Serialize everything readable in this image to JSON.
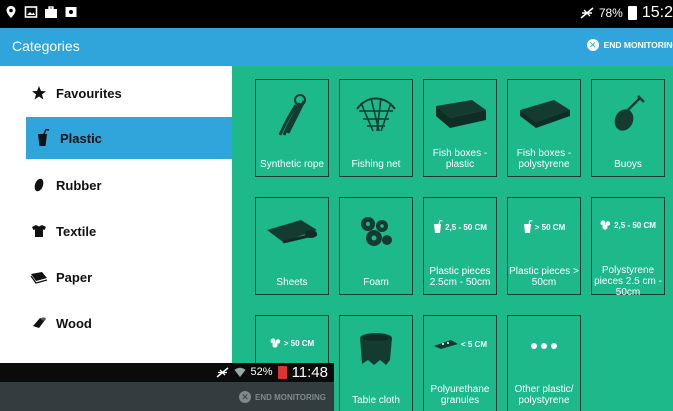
{
  "status_bar": {
    "battery": "78%",
    "time": "15:2"
  },
  "app_bar": {
    "title": "Categories",
    "end_monitoring": "END MONITORING"
  },
  "sidebar": {
    "items": [
      {
        "label": "Favourites",
        "icon": "star-icon"
      },
      {
        "label": "Plastic",
        "icon": "plastic-cup-icon",
        "active": true
      },
      {
        "label": "Rubber",
        "icon": "rubber-icon"
      },
      {
        "label": "Textile",
        "icon": "tshirt-icon"
      },
      {
        "label": "Paper",
        "icon": "paper-icon"
      },
      {
        "label": "Wood",
        "icon": "wood-icon"
      }
    ]
  },
  "tiles": [
    {
      "label": "Synthetic rope",
      "icon": "rope-icon"
    },
    {
      "label": "Fishing net",
      "icon": "fishing-net-icon"
    },
    {
      "label": "Fish boxes - plastic",
      "icon": "fish-box-icon"
    },
    {
      "label": "Fish boxes - polystyrene",
      "icon": "fish-box-polystyrene-icon"
    },
    {
      "label": "Buoys",
      "icon": "buoy-icon"
    },
    {
      "label": "Sheets",
      "icon": "sheet-roll-icon"
    },
    {
      "label": "Foam",
      "icon": "foam-icon"
    },
    {
      "label": "Plastic pieces 2.5cm - 50cm",
      "badge": "2,5 - 50 CM",
      "icon": "plastic-cup-icon"
    },
    {
      "label": "Plastic pieces > 50cm",
      "badge": "> 50 CM",
      "icon": "plastic-cup-icon"
    },
    {
      "label": "Polystyrene pieces 2.5 cm - 50cm",
      "badge": "2,5 - 50 CM",
      "icon": "polystyrene-icon"
    },
    {
      "label": "",
      "badge": "> 50 CM",
      "icon": "polystyrene-icon"
    },
    {
      "label": "Table cloth",
      "icon": "table-cloth-icon"
    },
    {
      "label": "Polyurethane granules",
      "badge": "< 5 CM",
      "icon": "granules-icon"
    },
    {
      "label": "Other plastic/ polystyrene",
      "icon": "more-dots-icon"
    }
  ],
  "overlay": {
    "battery": "52%",
    "time": "11:48",
    "end_monitoring": "END MONITORING"
  },
  "colors": {
    "accent": "#2fa5db",
    "grid_bg": "#1eb98b",
    "tile_border": "#143b30"
  }
}
